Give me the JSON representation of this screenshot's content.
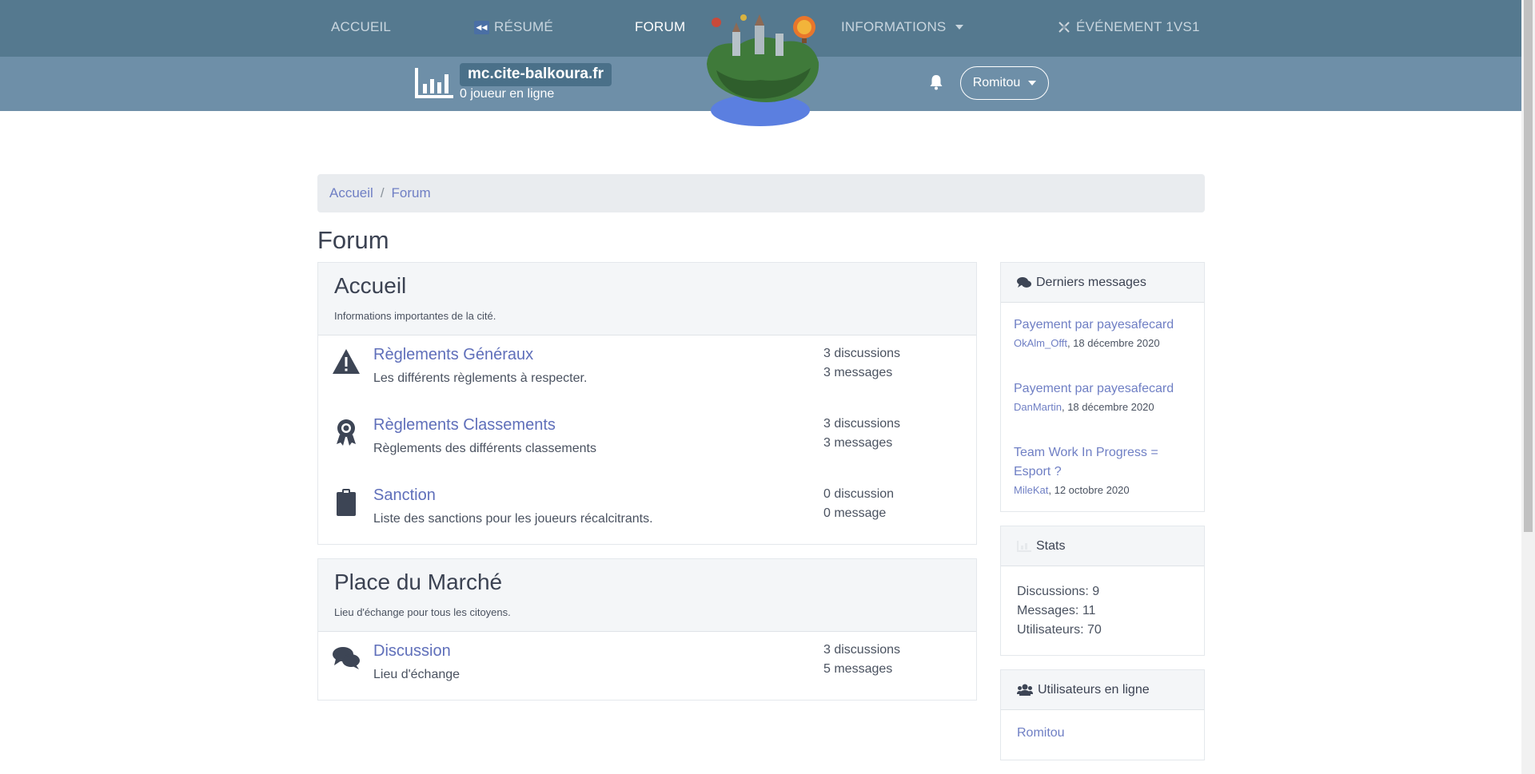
{
  "topnav": {
    "items": [
      {
        "label": "Accueil",
        "active": false
      },
      {
        "label": "Résumé",
        "icon": "rewind-icon",
        "active": false
      },
      {
        "label": "Forum",
        "active": true
      },
      {
        "label": "Informations",
        "dropdown": true,
        "active": false
      },
      {
        "label": "Événement 1vs1",
        "icon": "crossed-swords-icon",
        "active": false
      }
    ]
  },
  "server": {
    "name": "mc.cite-balkoura.fr",
    "online": "0 joueur en ligne",
    "icon": "bar-chart-icon"
  },
  "user_menu": {
    "label": "Romitou",
    "notifications_icon": "bell-icon"
  },
  "logo": {
    "icon": "floating-island-logo"
  },
  "breadcrumb": {
    "home": "Accueil",
    "current": "Forum"
  },
  "page_title": "Forum",
  "categories": [
    {
      "title": "Accueil",
      "description": "Informations importantes de la cité.",
      "forums": [
        {
          "icon": "warning-triangle-icon",
          "title": "Règlements Généraux",
          "description": "Les différents règlements à respecter.",
          "discussions": "3 discussions",
          "messages": "3 messages"
        },
        {
          "icon": "award-ribbon-icon",
          "title": "Règlements Classements",
          "description": "Règlements des différents classements",
          "discussions": "3 discussions",
          "messages": "3 messages"
        },
        {
          "icon": "clipboard-icon",
          "title": "Sanction",
          "description": "Liste des sanctions pour les joueurs récalcitrants.",
          "discussions": "0 discussion",
          "messages": "0 message"
        }
      ]
    },
    {
      "title": "Place du Marché",
      "description": "Lieu d'échange pour tous les citoyens.",
      "forums": [
        {
          "icon": "chat-bubbles-icon",
          "title": "Discussion",
          "description": "Lieu d'échange",
          "discussions": "3 discussions",
          "messages": "5 messages"
        }
      ]
    }
  ],
  "sidebar": {
    "latest": {
      "title": "Derniers messages",
      "icon": "comments-icon",
      "items": [
        {
          "title": "Payement par payesafecard",
          "author": "OkAlm_Offt",
          "date": ", 18 décembre 2020"
        },
        {
          "title": "Payement par payesafecard",
          "author": "DanMartin",
          "date": ", 18 décembre 2020"
        },
        {
          "title": "Team Work In Progress = Esport ?",
          "author": "MileKat",
          "date": ", 12 octobre 2020"
        }
      ]
    },
    "stats": {
      "title": "Stats",
      "icon": "chart-icon",
      "lines": [
        "Discussions: 9",
        "Messages: 11",
        "Utilisateurs: 70"
      ]
    },
    "online": {
      "title": "Utilisateurs en ligne",
      "icon": "users-icon",
      "users": [
        "Romitou"
      ]
    }
  },
  "colors": {
    "nav": "#55798f",
    "subbar": "#6e8fa8",
    "link": "#6f7fc4",
    "accent": "#4a7089"
  }
}
